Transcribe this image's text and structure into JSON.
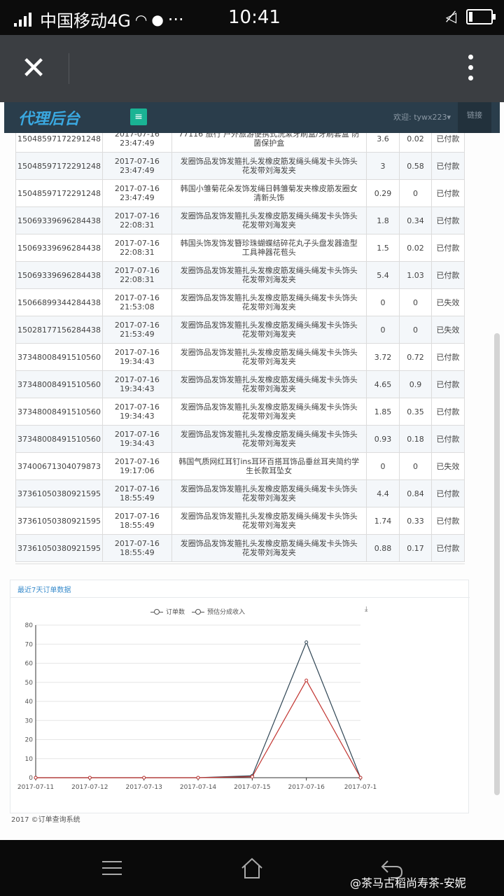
{
  "statusbar": {
    "carrier": "中国移动4G",
    "time": "10:41",
    "dots": "···"
  },
  "browser": {
    "close_icon": "close-icon",
    "more_icon": "more-vertical-icon"
  },
  "site": {
    "brand": "代理后台",
    "menu_icon": "≡",
    "user": "欢迎: tywx223▾",
    "logout": "链接"
  },
  "orders": [
    {
      "id": "15048597172291248",
      "date": "2017-07-16",
      "time": "23:47:49",
      "product": "77116 旅行 户外旅游便携式洗漱牙刷盒/牙刷套盒 防菌保护盒",
      "amount": "3.6",
      "commission": "0.02",
      "status": "已付款"
    },
    {
      "id": "15048597172291248",
      "date": "2017-07-16",
      "time": "23:47:49",
      "product": "发圈饰品发饰发箍扎头发橡皮筋发绳头绳发卡头饰头花发带刘海发夹",
      "amount": "3",
      "commission": "0.58",
      "status": "已付款"
    },
    {
      "id": "15048597172291248",
      "date": "2017-07-16",
      "time": "23:47:49",
      "product": "韩国小雏菊花朵发饰发绳日韩雏菊发夹橡皮筋发圈女清新头饰",
      "amount": "0.29",
      "commission": "0",
      "status": "已付款"
    },
    {
      "id": "15069339696284438",
      "date": "2017-07-16",
      "time": "22:08:31",
      "product": "发圈饰品发饰发箍扎头发橡皮筋发绳头绳发卡头饰头花发带刘海发夹",
      "amount": "1.8",
      "commission": "0.34",
      "status": "已付款"
    },
    {
      "id": "15069339696284438",
      "date": "2017-07-16",
      "time": "22:08:31",
      "product": "韩国头饰发饰发簪珍珠蝴蝶结碎花丸子头盘发器造型工具神器花苞头",
      "amount": "1.5",
      "commission": "0.02",
      "status": "已付款"
    },
    {
      "id": "15069339696284438",
      "date": "2017-07-16",
      "time": "22:08:31",
      "product": "发圈饰品发饰发箍扎头发橡皮筋发绳头绳发卡头饰头花发带刘海发夹",
      "amount": "5.4",
      "commission": "1.03",
      "status": "已付款"
    },
    {
      "id": "15066899344284438",
      "date": "2017-07-16",
      "time": "21:53:08",
      "product": "发圈饰品发饰发箍扎头发橡皮筋发绳头绳发卡头饰头花发带刘海发夹",
      "amount": "0",
      "commission": "0",
      "status": "已失效"
    },
    {
      "id": "15028177156284438",
      "date": "2017-07-16",
      "time": "21:53:49",
      "product": "发圈饰品发饰发箍扎头发橡皮筋发绳头绳发卡头饰头花发带刘海发夹",
      "amount": "0",
      "commission": "0",
      "status": "已失效"
    },
    {
      "id": "37348008491510560",
      "date": "2017-07-16",
      "time": "19:34:43",
      "product": "发圈饰品发饰发箍扎头发橡皮筋发绳头绳发卡头饰头花发带刘海发夹",
      "amount": "3.72",
      "commission": "0.72",
      "status": "已付款"
    },
    {
      "id": "37348008491510560",
      "date": "2017-07-16",
      "time": "19:34:43",
      "product": "发圈饰品发饰发箍扎头发橡皮筋发绳头绳发卡头饰头花发带刘海发夹",
      "amount": "4.65",
      "commission": "0.9",
      "status": "已付款"
    },
    {
      "id": "37348008491510560",
      "date": "2017-07-16",
      "time": "19:34:43",
      "product": "发圈饰品发饰发箍扎头发橡皮筋发绳头绳发卡头饰头花发带刘海发夹",
      "amount": "1.85",
      "commission": "0.35",
      "status": "已付款"
    },
    {
      "id": "37348008491510560",
      "date": "2017-07-16",
      "time": "19:34:43",
      "product": "发圈饰品发饰发箍扎头发橡皮筋发绳头绳发卡头饰头花发带刘海发夹",
      "amount": "0.93",
      "commission": "0.18",
      "status": "已付款"
    },
    {
      "id": "37400671304079873",
      "date": "2017-07-16",
      "time": "19:17:06",
      "product": "韩国气质网红耳钉ins耳环百搭耳饰品垂丝耳夹简约学生长款耳坠女",
      "amount": "0",
      "commission": "0",
      "status": "已失效"
    },
    {
      "id": "37361050380921595",
      "date": "2017-07-16",
      "time": "18:55:49",
      "product": "发圈饰品发饰发箍扎头发橡皮筋发绳头绳发卡头饰头花发带刘海发夹",
      "amount": "4.4",
      "commission": "0.84",
      "status": "已付款"
    },
    {
      "id": "37361050380921595",
      "date": "2017-07-16",
      "time": "18:55:49",
      "product": "发圈饰品发饰发箍扎头发橡皮筋发绳头绳发卡头饰头花发带刘海发夹",
      "amount": "1.74",
      "commission": "0.33",
      "status": "已付款"
    },
    {
      "id": "37361050380921595",
      "date": "2017-07-16",
      "time": "18:55:49",
      "product": "发圈饰品发饰发箍扎头发橡皮筋发绳头绳发卡头饰头花发带刘海发夹",
      "amount": "0.88",
      "commission": "0.17",
      "status": "已付款"
    }
  ],
  "chart_panel": {
    "title": "最近7天订单数据",
    "download_icon": "download-icon"
  },
  "chart_data": {
    "type": "line",
    "x": [
      "2017-07-11",
      "2017-07-12",
      "2017-07-13",
      "2017-07-14",
      "2017-07-15",
      "2017-07-16",
      "2017-07-1"
    ],
    "series": [
      {
        "name": "订单数",
        "values": [
          0,
          0,
          0,
          0,
          1,
          71,
          0
        ],
        "color": "#2f4554"
      },
      {
        "name": "预估分成收入",
        "values": [
          0,
          0,
          0,
          0,
          0.5,
          51,
          0
        ],
        "color": "#c23531"
      }
    ],
    "ylim": [
      0,
      80
    ],
    "yticks": [
      0,
      10,
      20,
      30,
      40,
      50,
      60,
      70,
      80
    ],
    "grid": true,
    "legend": "top-center"
  },
  "footer": {
    "text": "2017 ©订单查询系统"
  },
  "watermark": "@茶马古稻尚寿茶-安妮",
  "navbar": {
    "menu_icon": "menu-icon",
    "home_icon": "home-icon",
    "back_icon": "back-icon"
  }
}
